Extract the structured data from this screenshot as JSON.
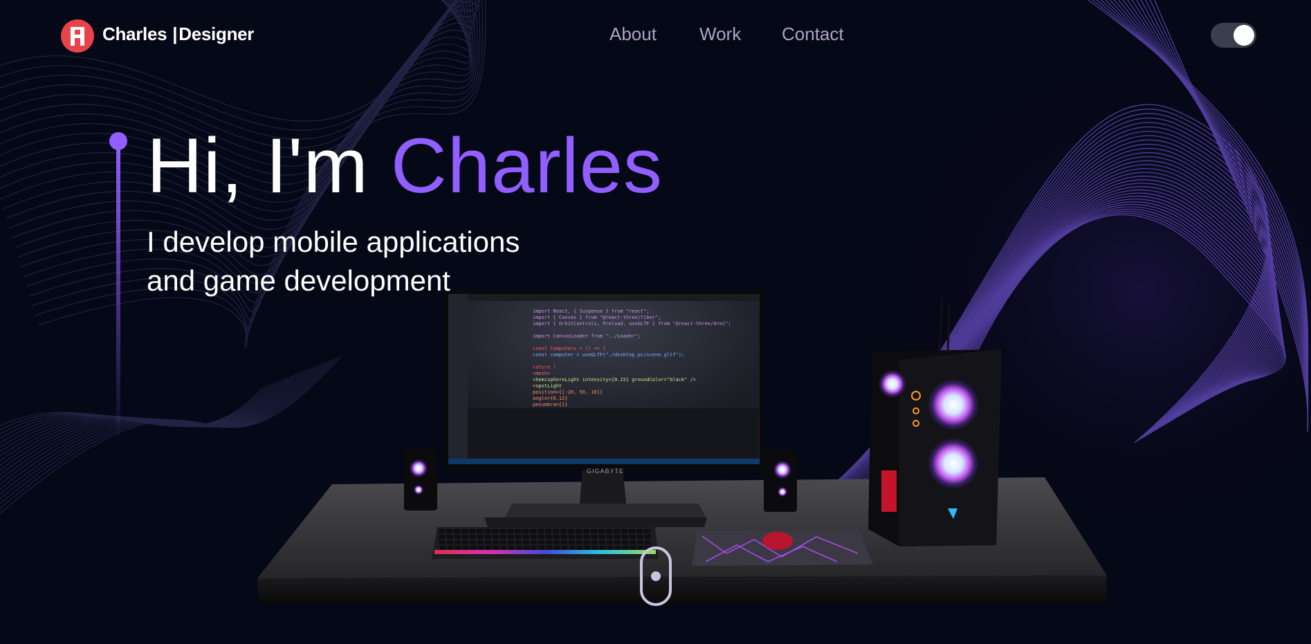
{
  "nav": {
    "brand_name": "Charles",
    "brand_separator": "|",
    "brand_role": "Designer",
    "logo_icon": "logo-icon",
    "links": [
      "About",
      "Work",
      "Contact"
    ],
    "theme_toggle_on": true
  },
  "hero": {
    "greeting": "Hi, I'm ",
    "name": "Charles",
    "subtitle_line1": "I develop mobile applications",
    "subtitle_line2": "and game development"
  },
  "monitor": {
    "brand": "GIGABYTE",
    "code_lines": [
      "import React, { Suspense } from \"react\";",
      "import { Canvas } from \"@react-three/fiber\";",
      "import { OrbitControls, Preload, useGLTF } from \"@react-three/drei\";",
      "",
      "import CanvasLoader from \"../Loader\";",
      "",
      "const Computers = () => {",
      "  const computer = useGLTF(\"./desktop_pc/scene.gltf\");",
      "",
      "  return (",
      "    <mesh>",
      "      <hemisphereLight intensity={0.15} groundColor=\"black\" />",
      "      <spotLight",
      "        position={[-20, 50, 10]}",
      "        angle={0.12}",
      "        penumbra={1}"
    ]
  },
  "colors": {
    "background": "#050816",
    "accent": "#915eff",
    "logo": "#e8434a",
    "nav_link": "#aaa6c3"
  },
  "icons": {
    "scroll": "mouse-scroll-icon"
  }
}
